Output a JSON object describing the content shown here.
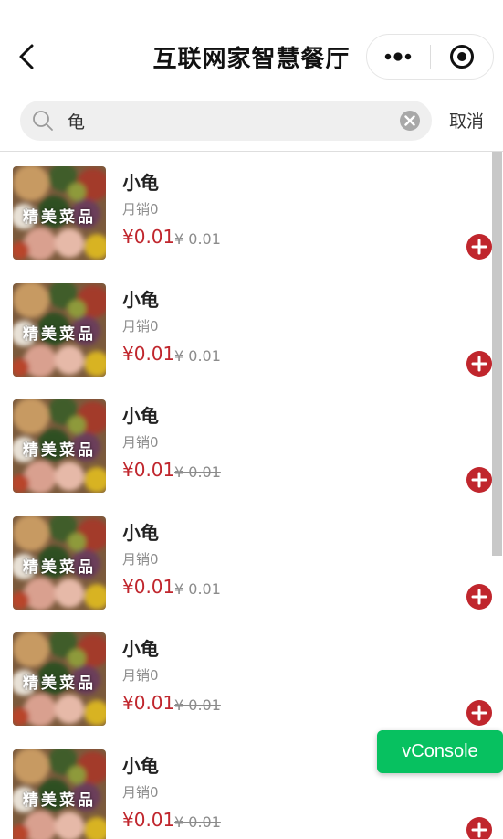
{
  "navbar": {
    "title": "互联网家智慧餐厅",
    "back_icon": "chevron-left-icon",
    "more_icon": "more-dots-icon",
    "close_icon": "target-close-icon"
  },
  "search": {
    "value": "龟",
    "placeholder": "",
    "cancel_label": "取消"
  },
  "colors": {
    "price": "#c0262d",
    "add_button": "#c0262d",
    "vconsole": "#07c160",
    "search_bg": "#efefef"
  },
  "items": [
    {
      "thumb_label": "精美菜品",
      "name": "小龟",
      "sales": "月销0",
      "price": "¥0.01",
      "original_price": "¥ 0.01"
    },
    {
      "thumb_label": "精美菜品",
      "name": "小龟",
      "sales": "月销0",
      "price": "¥0.01",
      "original_price": "¥ 0.01"
    },
    {
      "thumb_label": "精美菜品",
      "name": "小龟",
      "sales": "月销0",
      "price": "¥0.01",
      "original_price": "¥ 0.01"
    },
    {
      "thumb_label": "精美菜品",
      "name": "小龟",
      "sales": "月销0",
      "price": "¥0.01",
      "original_price": "¥ 0.01"
    },
    {
      "thumb_label": "精美菜品",
      "name": "小龟",
      "sales": "月销0",
      "price": "¥0.01",
      "original_price": "¥ 0.01"
    },
    {
      "thumb_label": "精美菜品",
      "name": "小龟",
      "sales": "月销0",
      "price": "¥0.01",
      "original_price": "¥ 0.01"
    }
  ],
  "vconsole": {
    "label": "vConsole"
  }
}
